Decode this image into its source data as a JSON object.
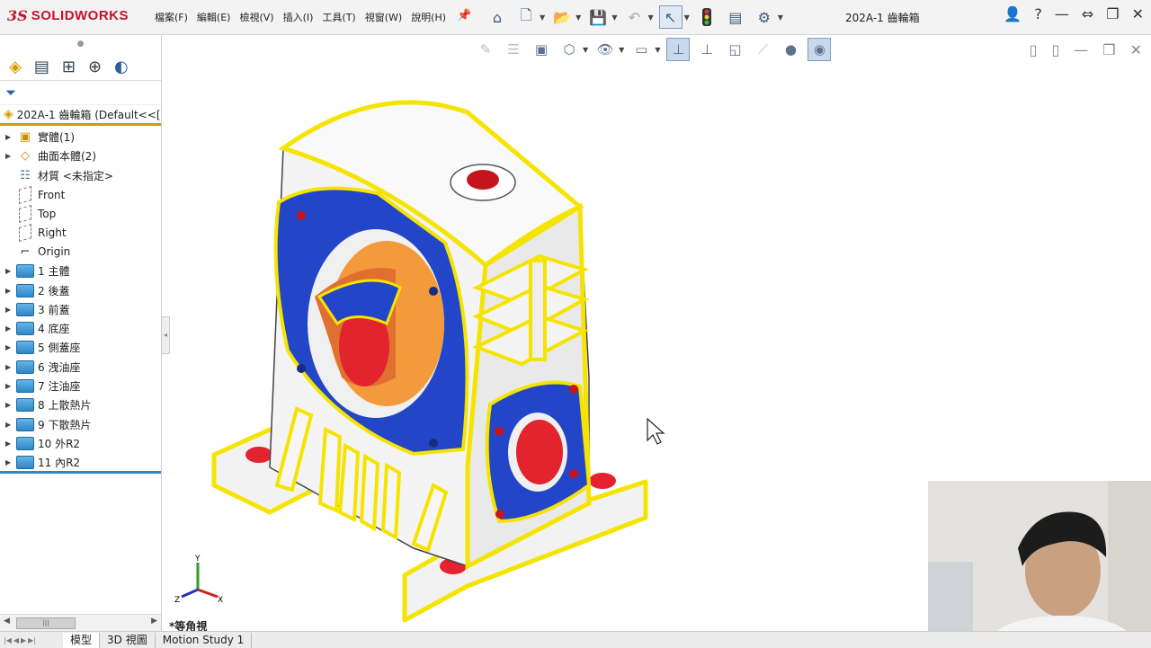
{
  "app": {
    "ds_mark": "3S",
    "name": "SOLIDWORKS",
    "document_title": "202A-1 齒輪箱"
  },
  "menu": [
    {
      "label": "檔案(F)"
    },
    {
      "label": "編輯(E)"
    },
    {
      "label": "檢視(V)"
    },
    {
      "label": "插入(I)"
    },
    {
      "label": "工具(T)"
    },
    {
      "label": "視窗(W)"
    },
    {
      "label": "說明(H)"
    }
  ],
  "feature_tree": {
    "root": "202A-1 齒輪箱  (Default<<[",
    "items": [
      {
        "label": "實體(1)",
        "icon": "solid-body-icon",
        "expandable": true
      },
      {
        "label": "曲面本體(2)",
        "icon": "surface-body-icon",
        "expandable": true
      },
      {
        "label": "材質 <未指定>",
        "icon": "material-icon",
        "expandable": false
      },
      {
        "label": "Front",
        "icon": "plane-icon",
        "expandable": false
      },
      {
        "label": "Top",
        "icon": "plane-icon",
        "expandable": false
      },
      {
        "label": "Right",
        "icon": "plane-icon",
        "expandable": false
      },
      {
        "label": "Origin",
        "icon": "origin-icon",
        "expandable": false
      },
      {
        "label": "1 主體",
        "icon": "folder-icon",
        "expandable": true
      },
      {
        "label": "2 後蓋",
        "icon": "folder-icon",
        "expandable": true
      },
      {
        "label": "3 前蓋",
        "icon": "folder-icon",
        "expandable": true
      },
      {
        "label": "4 底座",
        "icon": "folder-icon",
        "expandable": true
      },
      {
        "label": "5 側蓋座",
        "icon": "folder-icon",
        "expandable": true
      },
      {
        "label": "6 洩油座",
        "icon": "folder-icon",
        "expandable": true
      },
      {
        "label": "7 注油座",
        "icon": "folder-icon",
        "expandable": true
      },
      {
        "label": "8 上散熱片",
        "icon": "folder-icon",
        "expandable": true
      },
      {
        "label": "9 下散熱片",
        "icon": "folder-icon",
        "expandable": true
      },
      {
        "label": "10 外R2",
        "icon": "folder-icon",
        "expandable": true
      },
      {
        "label": "11 內R2",
        "icon": "folder-icon",
        "expandable": true
      }
    ]
  },
  "viewport": {
    "view_label": "*等角視",
    "triad": {
      "x": "X",
      "y": "Y",
      "z": "Z"
    }
  },
  "bottom_tabs": [
    {
      "label": "模型",
      "active": true
    },
    {
      "label": "3D 視圖",
      "active": false
    },
    {
      "label": "Motion Study 1",
      "active": false
    }
  ],
  "colors": {
    "accent_orange": "#d79b00",
    "face_blue": "#2346c8",
    "edge_yellow": "#f5e400",
    "inner_orange": "#f39a3c",
    "hole_red": "#e3232e"
  }
}
